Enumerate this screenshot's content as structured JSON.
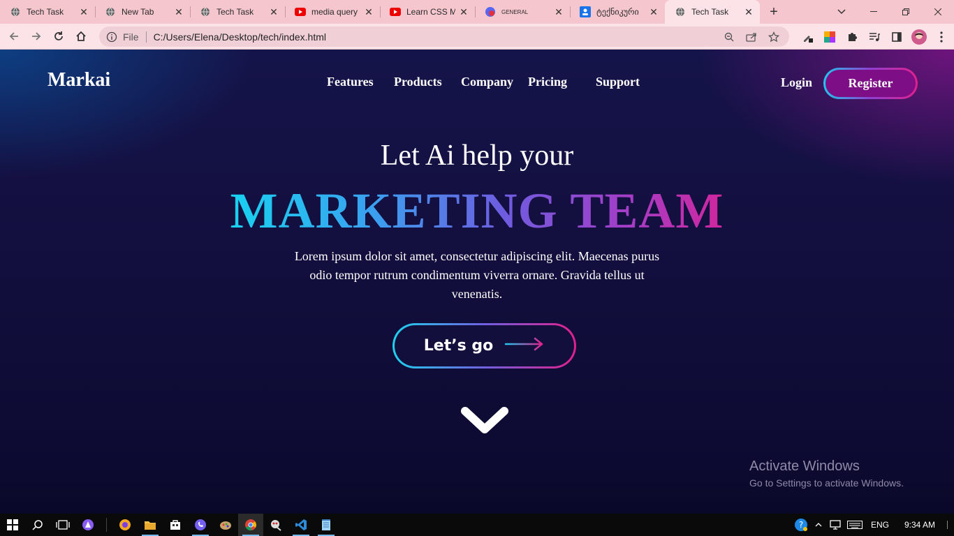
{
  "browser": {
    "tabs": [
      {
        "title": "Tech Task",
        "icon": "globe-icon",
        "active": false
      },
      {
        "title": "New Tab",
        "icon": "globe-icon",
        "active": false
      },
      {
        "title": "Tech Task",
        "icon": "globe-icon",
        "active": false
      },
      {
        "title": "media query",
        "icon": "youtube-icon",
        "active": false
      },
      {
        "title": "Learn CSS Me",
        "icon": "youtube-icon",
        "active": false
      },
      {
        "title": "GENERAL",
        "icon": "chat-app-icon",
        "active": false
      },
      {
        "title": "ტექნიკური",
        "icon": "classroom-icon",
        "active": false
      },
      {
        "title": "Tech Task",
        "icon": "globe-icon",
        "active": true
      }
    ],
    "address": {
      "scheme_label": "File",
      "url": "C:/Users/Elena/Desktop/tech/index.html"
    },
    "theme_color": "#f6c6ce"
  },
  "site": {
    "logo": "Markai",
    "nav": [
      "Features",
      "Products",
      "Company",
      "Pricing",
      "Support"
    ],
    "login": "Login",
    "register": "Register",
    "hero": {
      "subtitle": "Let Ai help your",
      "title": "MARKETING TEAM",
      "lead_lines": [
        "Lorem ipsum dolor sit amet, consectetur adipiscing elit. Maecenas purus",
        "odio tempor rutrum condimentum viverra ornare. Gravida tellus ut",
        "venenatis."
      ],
      "cta": "Let’s go"
    },
    "colors": {
      "gradient_start": "#18d2f0",
      "gradient_mid": "#6d5de0",
      "gradient_end": "#d0269e",
      "register_fill": "#7e0e86"
    }
  },
  "watermark": {
    "line1": "Activate Windows",
    "line2": "Go to Settings to activate Windows."
  },
  "taskbar": {
    "language": "ENG",
    "time": "9:34 AM"
  }
}
